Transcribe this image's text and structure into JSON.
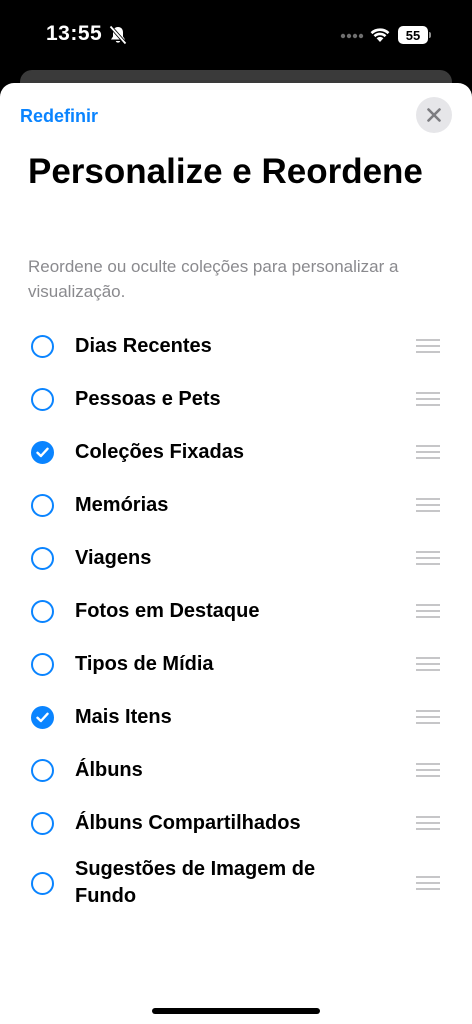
{
  "status": {
    "time": "13:55",
    "battery": "55",
    "icons": [
      "bell-slash-icon",
      "cellular-dots-icon",
      "wifi-icon",
      "battery-icon"
    ]
  },
  "sheet": {
    "reset_label": "Redefinir",
    "close_icon": "close-icon",
    "title": "Personalize e Reordene",
    "subtitle": "Reordene ou oculte coleções para personalizar a visualização."
  },
  "collections": [
    {
      "label": "Dias Recentes",
      "checked": false
    },
    {
      "label": "Pessoas e Pets",
      "checked": false
    },
    {
      "label": "Coleções Fixadas",
      "checked": true
    },
    {
      "label": "Memórias",
      "checked": false
    },
    {
      "label": "Viagens",
      "checked": false
    },
    {
      "label": "Fotos em Destaque",
      "checked": false
    },
    {
      "label": "Tipos de Mídia",
      "checked": false
    },
    {
      "label": "Mais Itens",
      "checked": true
    },
    {
      "label": "Álbuns",
      "checked": false
    },
    {
      "label": "Álbuns Compartilhados",
      "checked": false
    },
    {
      "label": "Sugestões de Imagem de Fundo",
      "checked": false
    }
  ],
  "colors": {
    "accent": "#0a84ff",
    "secondary_text": "#8a8a8e",
    "handle": "#c6c6c8"
  }
}
